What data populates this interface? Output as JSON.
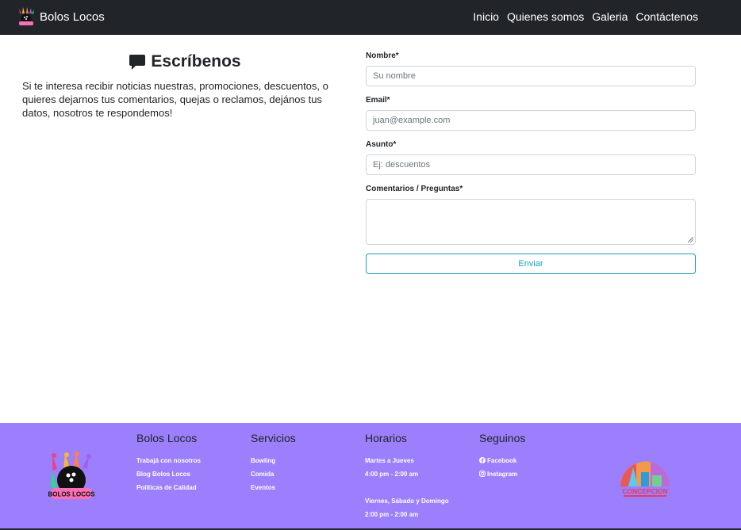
{
  "navbar": {
    "brand": "Bolos Locos",
    "links": [
      "Inicio",
      "Quienes somos",
      "Galeria",
      "Contáctenos"
    ]
  },
  "contact": {
    "heading": "Escríbenos",
    "intro": "Si te interesa recibir noticias nuestras, promociones, descuentos, o quieres dejarnos tus comentarios, quejas o reclamos, dejános tus datos, nosotros te respondemos!"
  },
  "form": {
    "name_label": "Nombre*",
    "name_placeholder": "Su nombre",
    "email_label": "Email*",
    "email_placeholder": "juan@example.com",
    "subject_label": "Asunto*",
    "subject_placeholder": "Ej: descuentos",
    "comments_label": "Comentarios / Preguntas*",
    "submit_label": "Enviar"
  },
  "footer": {
    "logo_text": "BOLOS LOCOS",
    "col1": {
      "title": "Bolos Locos",
      "items": [
        "Trabajá con nosotros",
        "Blog Bolos Locos",
        "Políticas de Calidad"
      ]
    },
    "col2": {
      "title": "Servicios",
      "items": [
        "Bowling",
        "Comida",
        "Eventos"
      ]
    },
    "col3": {
      "title": "Horarios",
      "items": [
        "Martes a Jueves",
        "4:00 pm - 2:00 am",
        "Viernes, Sábado y Domingo",
        "2:00 pm - 2:00 am"
      ]
    },
    "col4": {
      "title": "Seguinos",
      "items": [
        "Facebook",
        "Instagram"
      ]
    },
    "badge_text": "CONCEPCION"
  },
  "colors": {
    "navbar": "#212529",
    "footer": "#9b7ffc",
    "accent": "#17a2b8"
  }
}
